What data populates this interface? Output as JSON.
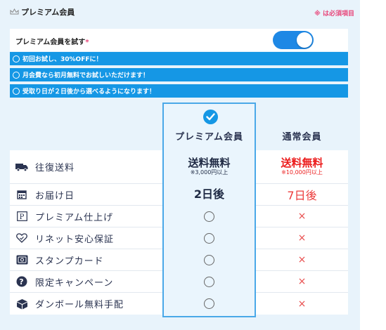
{
  "section": {
    "title": "プレミアム会員",
    "required_note": "※ は必須項目"
  },
  "trial": {
    "label": "プレミアム会員を試す",
    "required_mark": "*",
    "toggle_state": "on"
  },
  "benefits": [
    "初回お試し、30%OFFに！",
    "月会費なら初月無料でお試しいただけます！",
    "受取り日が２日後から選べるようになります！"
  ],
  "comparison": {
    "columns": {
      "premium": "プレミアム会員",
      "normal": "通常会員"
    },
    "rows": [
      {
        "feature": "往復送料",
        "icon": "truck-icon",
        "premium": {
          "main": "送料無料",
          "sub": "※3,000円以上"
        },
        "normal": {
          "main": "送料無料",
          "sub": "※10,000円以上"
        }
      },
      {
        "feature": "お届け日",
        "icon": "calendar-icon",
        "premium": {
          "main": "2日後"
        },
        "normal": {
          "main": "7日後"
        }
      },
      {
        "feature": "プレミアム仕上げ",
        "icon": "p-badge-icon",
        "premium": {
          "symbol": "○"
        },
        "normal": {
          "symbol": "×"
        }
      },
      {
        "feature": "リネット安心保証",
        "icon": "heart-icon",
        "premium": {
          "symbol": "○"
        },
        "normal": {
          "symbol": "×"
        }
      },
      {
        "feature": "スタンプカード",
        "icon": "stamp-card-icon",
        "premium": {
          "symbol": "○"
        },
        "normal": {
          "symbol": "×"
        }
      },
      {
        "feature": "限定キャンペーン",
        "icon": "question-icon",
        "premium": {
          "symbol": "○"
        },
        "normal": {
          "symbol": "×"
        }
      },
      {
        "feature": "ダンボール無料手配",
        "icon": "box-icon",
        "premium": {
          "symbol": "○"
        },
        "normal": {
          "symbol": "×"
        }
      }
    ]
  },
  "colors": {
    "accent": "#1597e5",
    "panel_bg": "#e8f3fb",
    "required": "#e8467a",
    "negative": "#ec1d1d"
  }
}
